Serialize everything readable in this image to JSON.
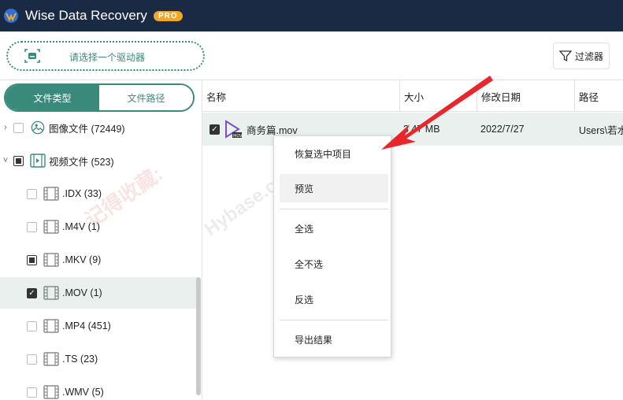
{
  "app": {
    "title": "Wise Data Recovery",
    "badge": "PRO"
  },
  "toolbar": {
    "drive_label": "请选择一个驱动器",
    "filter_label": "过滤器"
  },
  "sidebar": {
    "tabs": [
      {
        "label": "文件类型",
        "active": true
      },
      {
        "label": "文件路径",
        "active": false
      }
    ],
    "items": [
      {
        "label": "图像文件 (72449)",
        "icon": "image-icon",
        "checkbox": "unchecked",
        "expand": ">"
      },
      {
        "label": "视频文件 (523)",
        "icon": "video-icon",
        "checkbox": "partial",
        "expand": "v"
      },
      {
        "label": ".IDX (33)",
        "icon": "film-icon",
        "checkbox": "unchecked"
      },
      {
        "label": ".M4V (1)",
        "icon": "film-icon",
        "checkbox": "unchecked"
      },
      {
        "label": ".MKV (9)",
        "icon": "film-icon",
        "checkbox": "partial"
      },
      {
        "label": ".MOV (1)",
        "icon": "film-icon",
        "checkbox": "checked",
        "selected": true
      },
      {
        "label": ".MP4 (451)",
        "icon": "film-icon",
        "checkbox": "unchecked"
      },
      {
        "label": ".TS (23)",
        "icon": "film-icon",
        "checkbox": "unchecked"
      },
      {
        "label": ".WMV (5)",
        "icon": "film-icon",
        "checkbox": "unchecked"
      }
    ]
  },
  "table": {
    "columns": [
      "名称",
      "大小",
      "修改日期",
      "路径"
    ],
    "rows": [
      {
        "name": "商务篇.mov",
        "size": "3.47 MB",
        "size_visible": "3   47 MB",
        "date": "2022/7/27",
        "path": "Users\\若水"
      }
    ]
  },
  "context_menu": {
    "items": [
      "恢复选中项目",
      "预览",
      "全选",
      "全不选",
      "反选",
      "导出结果"
    ],
    "hovered": "预览"
  },
  "watermark": {
    "text_red": "记得收藏:",
    "text_grey": "Hybase.com"
  },
  "colors": {
    "titlebar": "#1b2a44",
    "accent": "#3a8a7c",
    "badge": "#f5a623",
    "arrow": "#e8262b"
  }
}
